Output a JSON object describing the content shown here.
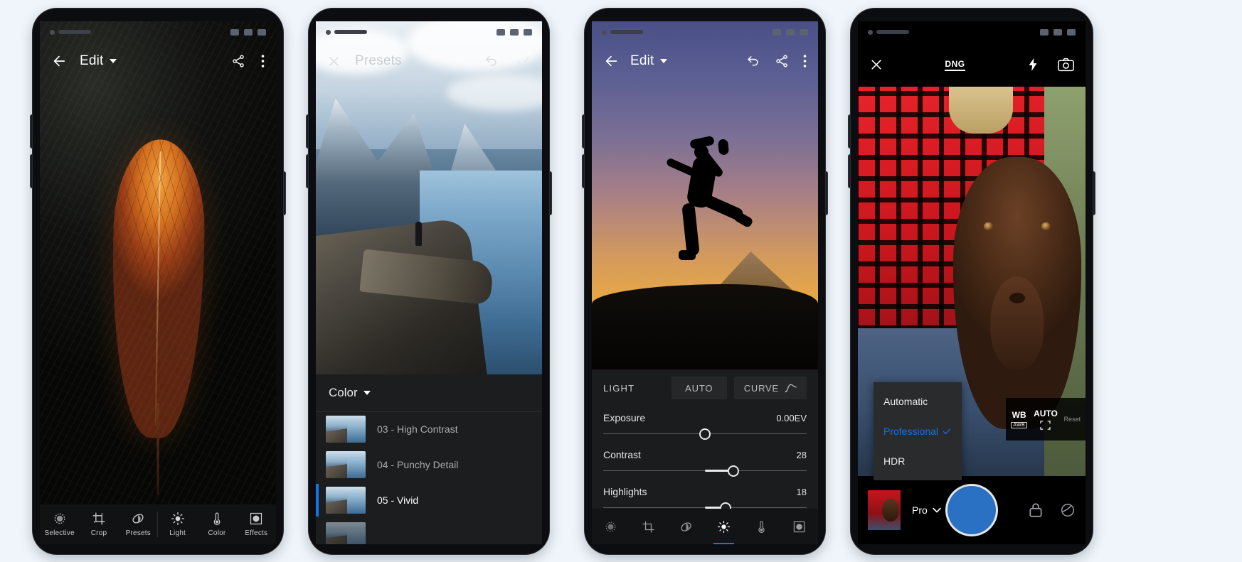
{
  "canvas": {
    "background": "#eff5fa"
  },
  "accent": {
    "blue": "#1473e6",
    "shutter_blue": "#2a71c4"
  },
  "phones": [
    {
      "id": "lightroom-edit-leaf",
      "appbar": {
        "back_icon": "arrow-left-icon",
        "title": "Edit",
        "dropdown_icon": "caret-down-icon",
        "share_icon": "share-icon",
        "overflow_icon": "more-vertical-icon"
      },
      "toolbar": [
        {
          "label": "Selective",
          "icon": "selective-icon"
        },
        {
          "label": "Crop",
          "icon": "crop-icon"
        },
        {
          "label": "Presets",
          "icon": "presets-icon"
        },
        {
          "label": "Light",
          "icon": "light-sun-icon"
        },
        {
          "label": "Color",
          "icon": "color-thermometer-icon"
        },
        {
          "label": "Effects",
          "icon": "effects-frame-icon"
        }
      ]
    },
    {
      "id": "lightroom-presets",
      "appbar": {
        "close_icon": "close-x-icon",
        "title": "Presets",
        "undo_icon": "undo-icon",
        "confirm_icon": "check-icon"
      },
      "group": {
        "label": "Color",
        "dropdown_icon": "caret-down-icon"
      },
      "presets": [
        {
          "name": "03 - High Contrast",
          "selected": false
        },
        {
          "name": "04 - Punchy Detail",
          "selected": false
        },
        {
          "name": "05 - Vivid",
          "selected": true
        }
      ]
    },
    {
      "id": "lightroom-light",
      "appbar": {
        "back_icon": "arrow-left-icon",
        "title": "Edit",
        "dropdown_icon": "caret-down-icon",
        "undo_icon": "undo-icon",
        "share_icon": "share-icon",
        "overflow_icon": "more-vertical-icon"
      },
      "panel": {
        "section_title": "LIGHT",
        "auto_label": "AUTO",
        "curve_label": "CURVE",
        "curve_icon": "tone-curve-icon"
      },
      "sliders": [
        {
          "name": "Exposure",
          "value": "0.00EV",
          "pos_pct": 50,
          "fill_from_pct": 50
        },
        {
          "name": "Contrast",
          "value": "28",
          "pos_pct": 64,
          "fill_from_pct": 50
        },
        {
          "name": "Highlights",
          "value": "18",
          "pos_pct": 60,
          "fill_from_pct": 50
        }
      ],
      "toolbar": [
        {
          "icon": "selective-icon",
          "active": false
        },
        {
          "icon": "crop-icon",
          "active": false
        },
        {
          "icon": "presets-icon",
          "active": false
        },
        {
          "icon": "light-sun-icon",
          "active": true
        },
        {
          "icon": "color-thermometer-icon",
          "active": false
        },
        {
          "icon": "effects-frame-icon",
          "active": false
        }
      ]
    },
    {
      "id": "lightroom-camera",
      "topbar": {
        "close_icon": "close-x-icon",
        "format_label": "DNG",
        "flash_icon": "flash-icon",
        "switch_camera_icon": "camera-switch-icon"
      },
      "mode_menu": {
        "options": [
          {
            "label": "Automatic",
            "selected": false
          },
          {
            "label": "Professional",
            "selected": true
          },
          {
            "label": "HDR",
            "selected": false
          }
        ],
        "check_icon": "check-icon"
      },
      "controls": [
        {
          "label": "WB",
          "sub": "AWB",
          "icon": "lock-icon",
          "dim": false
        },
        {
          "label": "AUTO",
          "sub": "",
          "icon": "focus-brackets-icon",
          "dim": false
        },
        {
          "label": "Reset",
          "sub": "",
          "icon": "more-vertical-icon",
          "dim": true
        }
      ],
      "bottombar": {
        "thumbnail_name": "last-photo-thumbnail",
        "mode_label": "Pro",
        "mode_caret_icon": "caret-down-icon",
        "shutter_name": "shutter-button",
        "lock_icon": "exposure-lock-icon",
        "settings_icon": "camera-settings-icon"
      }
    }
  ]
}
